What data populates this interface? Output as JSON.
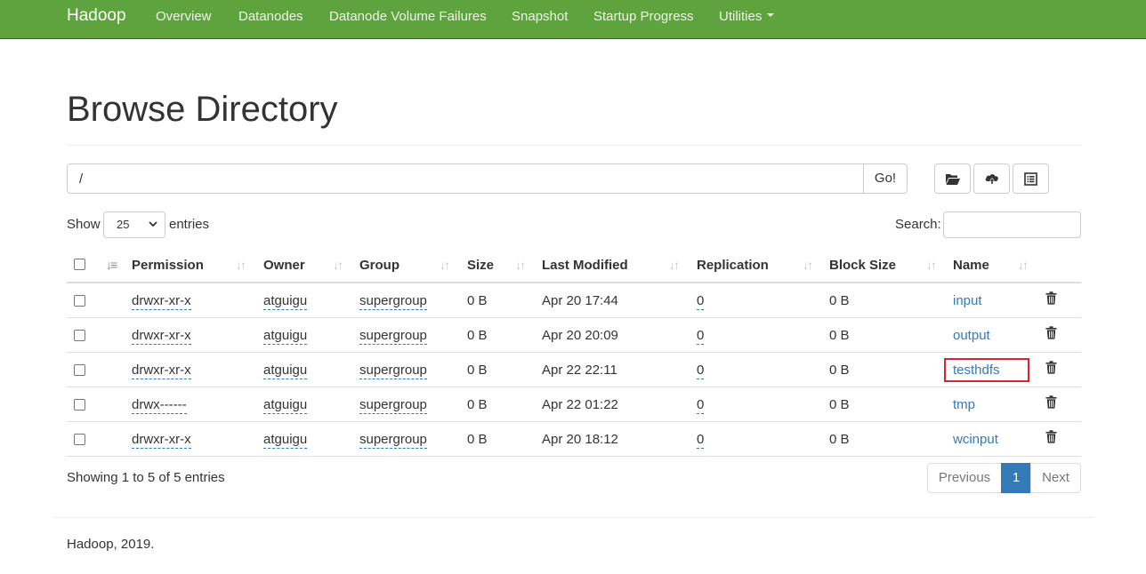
{
  "navbar": {
    "brand": "Hadoop",
    "links": [
      "Overview",
      "Datanodes",
      "Datanode Volume Failures",
      "Snapshot",
      "Startup Progress",
      "Utilities"
    ],
    "bg_color": "#5fa33e"
  },
  "page": {
    "title": "Browse Directory"
  },
  "path_bar": {
    "value": "/",
    "go_label": "Go!"
  },
  "toolbar_icons": [
    "folder-open-icon",
    "cloud-upload-icon",
    "list-alt-icon"
  ],
  "table_controls": {
    "show_label": "Show",
    "entries_value": "25",
    "entries_label": "entries",
    "search_label": "Search:"
  },
  "table": {
    "columns": [
      "Permission",
      "Owner",
      "Group",
      "Size",
      "Last Modified",
      "Replication",
      "Block Size",
      "Name"
    ],
    "rows": [
      {
        "permission": "drwxr-xr-x",
        "owner": "atguigu",
        "group": "supergroup",
        "size": "0 B",
        "modified": "Apr 20 17:44",
        "replication": "0",
        "block_size": "0 B",
        "name": "input"
      },
      {
        "permission": "drwxr-xr-x",
        "owner": "atguigu",
        "group": "supergroup",
        "size": "0 B",
        "modified": "Apr 20 20:09",
        "replication": "0",
        "block_size": "0 B",
        "name": "output"
      },
      {
        "permission": "drwxr-xr-x",
        "owner": "atguigu",
        "group": "supergroup",
        "size": "0 B",
        "modified": "Apr 22 22:11",
        "replication": "0",
        "block_size": "0 B",
        "name": "testhdfs"
      },
      {
        "permission": "drwx------",
        "owner": "atguigu",
        "group": "supergroup",
        "size": "0 B",
        "modified": "Apr 22 01:22",
        "replication": "0",
        "block_size": "0 B",
        "name": "tmp"
      },
      {
        "permission": "drwxr-xr-x",
        "owner": "atguigu",
        "group": "supergroup",
        "size": "0 B",
        "modified": "Apr 20 18:12",
        "replication": "0",
        "block_size": "0 B",
        "name": "wcinput"
      }
    ],
    "highlight_color": "#d9262b"
  },
  "pagination": {
    "info": "Showing 1 to 5 of 5 entries",
    "previous": "Previous",
    "current": "1",
    "next": "Next",
    "accent": "#337ab7"
  },
  "footer": {
    "text": "Hadoop, 2019."
  }
}
